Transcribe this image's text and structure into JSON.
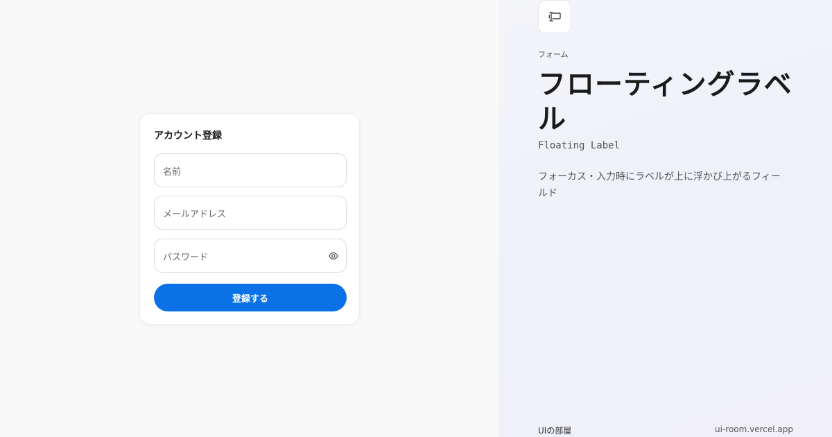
{
  "form": {
    "title": "アカウント登録",
    "fields": [
      {
        "label": "名前"
      },
      {
        "label": "メールアドレス"
      },
      {
        "label": "パスワード"
      }
    ],
    "submit_label": "登録する"
  },
  "info": {
    "category": "フォーム",
    "title": "フローティングラベル",
    "subtitle": "Floating Label",
    "description": "フォーカス・入力時にラベルが上に浮かび上がるフィールド",
    "brand": "UIの部屋",
    "url": "ui-room.vercel.app"
  },
  "colors": {
    "accent": "#0a72e6"
  },
  "icons": {
    "app": "label-icon",
    "password_toggle": "eye-icon"
  }
}
